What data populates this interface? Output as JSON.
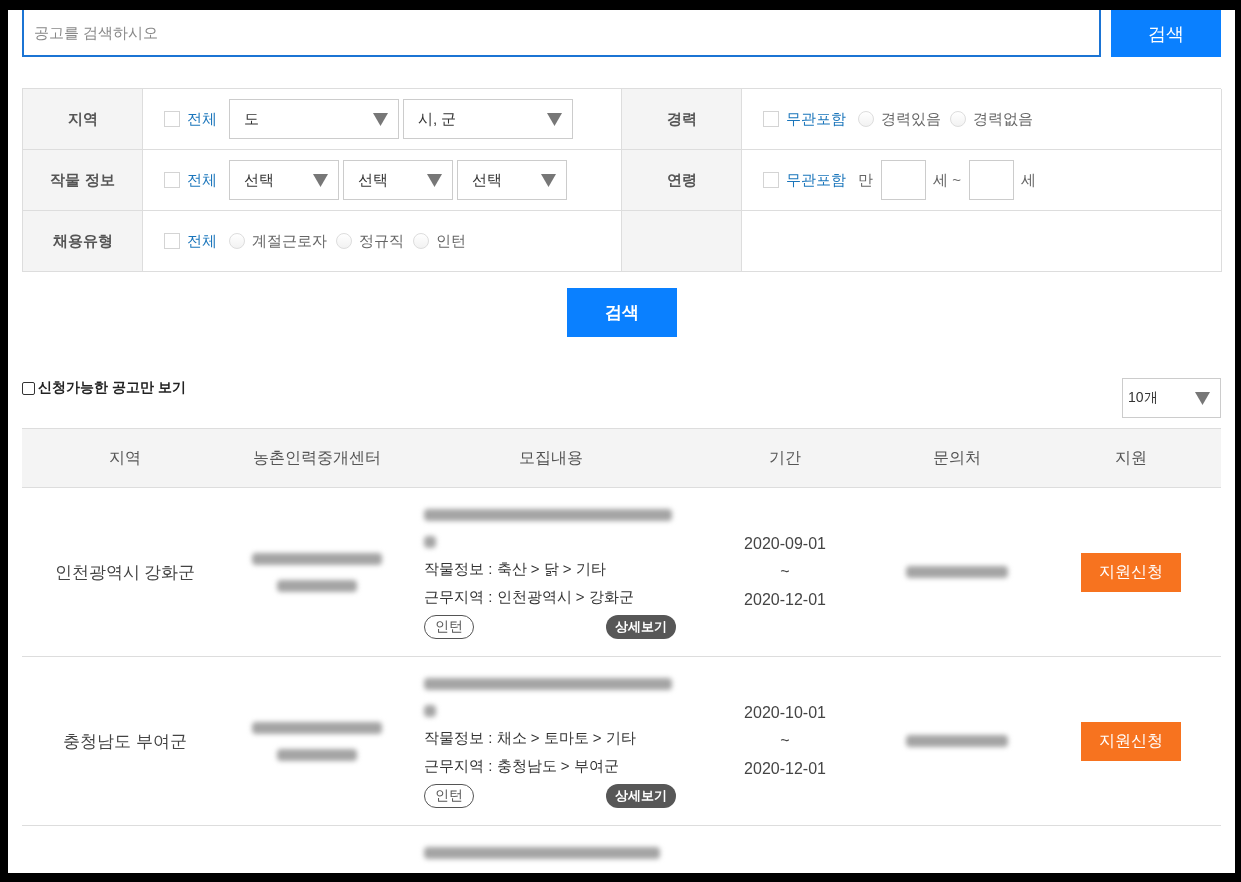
{
  "search": {
    "placeholder": "공고를 검색하시오",
    "button": "검색"
  },
  "filters": [
    {
      "label": "지역",
      "controls": [
        {
          "kind": "checkbox",
          "label": "전체",
          "checked": false
        },
        {
          "kind": "select",
          "value": "도"
        },
        {
          "kind": "select",
          "value": "시, 군"
        }
      ]
    },
    {
      "label": "경력",
      "controls": [
        {
          "kind": "checkbox",
          "label": "무관포함",
          "checked": false
        },
        {
          "kind": "radio",
          "label": "경력있음",
          "selected": false
        },
        {
          "kind": "radio",
          "label": "경력없음",
          "selected": false
        }
      ]
    },
    {
      "label": "작물 정보",
      "controls": [
        {
          "kind": "checkbox",
          "label": "전체",
          "checked": false
        },
        {
          "kind": "select",
          "value": "선택"
        },
        {
          "kind": "select",
          "value": "선택"
        },
        {
          "kind": "select",
          "value": "선택"
        }
      ]
    },
    {
      "label": "연령",
      "controls": [
        {
          "kind": "checkbox",
          "label": "무관포함",
          "checked": false
        },
        {
          "kind": "text",
          "text": "만"
        },
        {
          "kind": "input"
        },
        {
          "kind": "text",
          "text": "세 ~"
        },
        {
          "kind": "input"
        },
        {
          "kind": "text",
          "text": "세"
        }
      ]
    },
    {
      "label": "채용유형",
      "controls": [
        {
          "kind": "checkbox",
          "label": "전체",
          "checked": false
        },
        {
          "kind": "radio",
          "label": "계절근로자",
          "selected": false
        },
        {
          "kind": "radio",
          "label": "정규직",
          "selected": false
        },
        {
          "kind": "radio",
          "label": "인턴",
          "selected": false
        }
      ]
    }
  ],
  "filter_button": "검색",
  "available_only": {
    "label": "신청가능한 공고만 보기",
    "checked": false
  },
  "page_size": {
    "value": "10개"
  },
  "table": {
    "columns": [
      "지역",
      "농촌인력중개센터",
      "모집내용",
      "기간",
      "문의처",
      "지원"
    ],
    "rows": [
      {
        "kind": "full",
        "region": "인천광역시 강화군",
        "crop_info": "작물정보 : 축산 > 닭 > 기타",
        "work_area": "근무지역 : 인천광역시 > 강화군",
        "tag": "인턴",
        "detail_button": "상세보기",
        "period": [
          "2020-09-01",
          "~",
          "2020-12-01"
        ],
        "apply_button": "지원신청"
      },
      {
        "kind": "full",
        "region": "충청남도 부여군",
        "crop_info": "작물정보 : 채소 > 토마토 > 기타",
        "work_area": "근무지역 : 충청남도 > 부여군",
        "tag": "인턴",
        "detail_button": "상세보기",
        "period": [
          "2020-10-01",
          "~",
          "2020-12-01"
        ],
        "apply_button": "지원신청"
      },
      {
        "kind": "partial"
      }
    ]
  }
}
